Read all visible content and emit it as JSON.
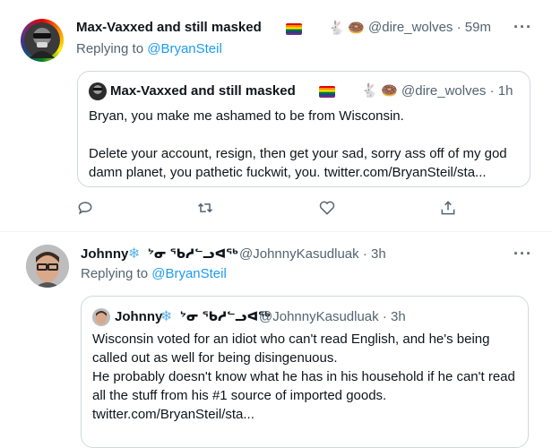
{
  "tweet1": {
    "display_name": "Max-Vaxxed and still masked",
    "handle": "@dire_wolves",
    "time": "59m",
    "replying_prefix": "Replying to ",
    "replying_to": "@BryanSteil",
    "emojis": [
      "rainbow-flag",
      "rabbit",
      "donut"
    ],
    "quote": {
      "display_name": "Max-Vaxxed and still masked",
      "handle": "@dire_wolves",
      "time": "1h",
      "line1": "Bryan,  you make me ashamed to be from Wisconsin.",
      "line2": "Delete your account, resign, then get your sad, sorry ass off of my god",
      "line3": "damn planet, you pathetic fuckwit, you. twitter.com/BryanSteil/sta..."
    }
  },
  "tweet2": {
    "display_name": "Johnny",
    "name_extra": "ᔾᓂ ᖃᓱᓪᓗᐊᖅ",
    "handle": "@JohnnyKasudluak",
    "time": "3h",
    "replying_prefix": "Replying to ",
    "replying_to": "@BryanSteil",
    "quote": {
      "display_name": "Johnny",
      "name_extra": "ᔾᓂ ᖃᓱᓪᓗᐊᖅ",
      "handle": "@JohnnyKasudluak",
      "time": "3h",
      "line1": "Wisconsin voted for an idiot who can't read English, and he's being",
      "line2": "called out as well for being disingenuous.",
      "line3": "He probably doesn't know what he has in his household if he can't read",
      "line4": "all the stuff from his #1 source of imported goods.",
      "line5": "twitter.com/BryanSteil/sta..."
    }
  },
  "separator": "·",
  "more_label": "···",
  "colors": {
    "accent": "#1d9bf0",
    "secondary_text": "#536471",
    "border": "#cfd9de"
  }
}
